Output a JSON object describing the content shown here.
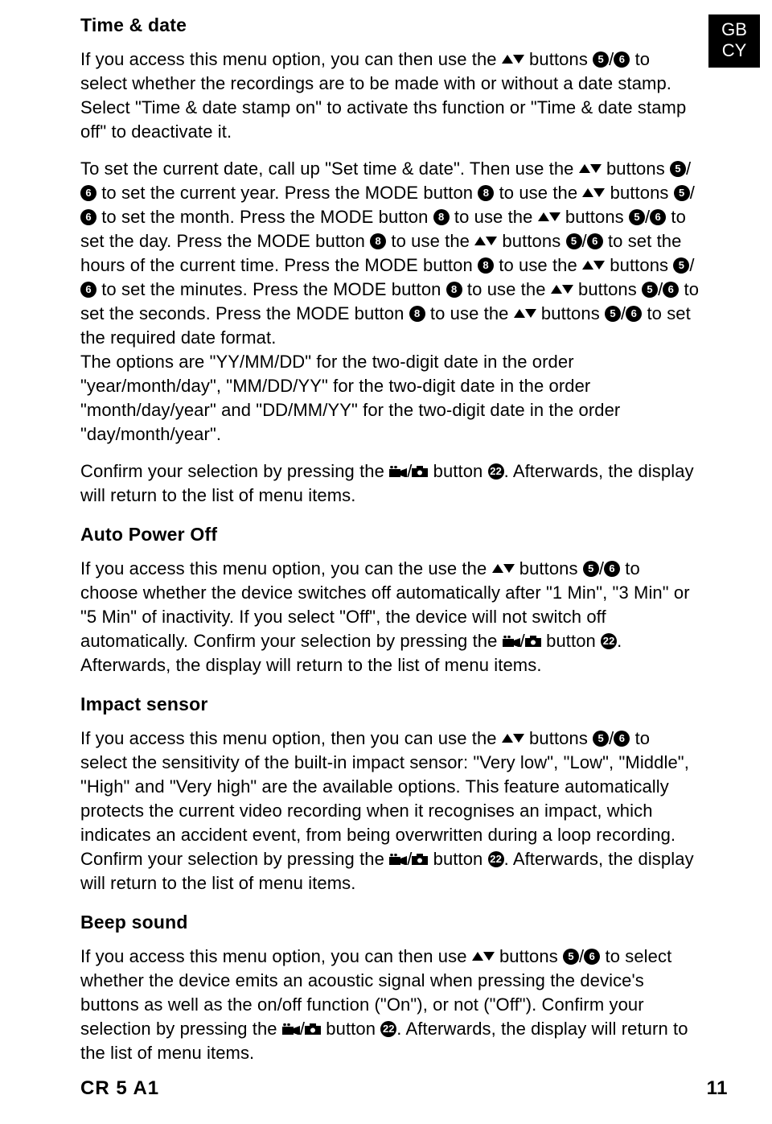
{
  "lang_tab": {
    "line1": "GB",
    "line2": "CY"
  },
  "footer": {
    "model": "CR 5 A1",
    "page": "11"
  },
  "refs": {
    "five": "5",
    "six": "6",
    "eight": "8",
    "twentytwo": "22"
  },
  "sections": {
    "time_date": {
      "heading": "Time & date",
      "p1a": "If you access this menu option, you can then use the ",
      "p1b": " buttons ",
      "p1c": "/",
      "p1d": " to select whether the recordings are to be made with or without a date stamp. Select \"Time & date stamp on\" to activate ths function or \"Time & date stamp off\" to deactivate it.",
      "p2a": "To set the current date, call up \"Set time & date\". Then use the ",
      "p2b": " buttons ",
      "p2c": "/",
      "p2d": " to set the current year. Press the MODE button ",
      "p2e": " to use the ",
      "p2f": " buttons ",
      "p2g": "/",
      "p2h": " to set the month. Press the MODE button ",
      "p2i": " to use the ",
      "p2j": " buttons ",
      "p2k": "/",
      "p2l": " to set the day. Press the MODE button ",
      "p2m": " to use the ",
      "p2n": " buttons ",
      "p2o": "/",
      "p2p": " to set the hours of the current time. Press the MODE button ",
      "p2q": " to use the ",
      "p2r": " buttons ",
      "p2s": "/",
      "p2t": " to set the minutes. Press the MODE button ",
      "p2u": " to use the ",
      "p2v": " buttons ",
      "p2w": "/",
      "p2x": " to set the seconds. Press the MODE button ",
      "p2y": " to use the ",
      "p2z": " buttons ",
      "p2aa": "/",
      "p2ab": " to set the required date format.",
      "p2ac": "The options are \"YY/MM/DD\" for the two-digit date in the order \"year/month/day\", \"MM/DD/YY\" for the two-digit date in the order \"month/day/year\" and \"DD/MM/YY\" for the two-digit date in the order \"day/month/year\".",
      "p3a": "Confirm your selection by pressing the ",
      "p3b": "/",
      "p3c": " button ",
      "p3d": ". Afterwards, the display will return to the list of menu items."
    },
    "auto_power_off": {
      "heading": "Auto Power Off",
      "p1a": "If you access this menu option, you can the use the ",
      "p1b": " buttons ",
      "p1c": "/",
      "p1d": " to choose whether the device switches off automatically after \"1 Min\", \"3 Min\" or \"5 Min\" of inactivity. If you select \"Off\", the device will not switch off automatically. Confirm your selection by pressing the ",
      "p1e": "/",
      "p1f": " button ",
      "p1g": ". Afterwards, the display will return to the list of menu items."
    },
    "impact_sensor": {
      "heading": "Impact sensor",
      "p1a": "If you access this menu option, then you can use the ",
      "p1b": " buttons ",
      "p1c": "/",
      "p1d": " to select the sensitivity of the built-in impact sensor: \"Very low\", \"Low\", \"Middle\", \"High\" and \"Very high\" are the available options. This feature automatically protects the current video recording when it recognises an impact, which indicates an accident event, from being overwritten during a loop recording. Confirm your selection by pressing the ",
      "p1e": "/",
      "p1f": " button ",
      "p1g": ". Afterwards, the display will return to the list of menu items."
    },
    "beep_sound": {
      "heading": "Beep sound",
      "p1a": "If you access this menu option, you can then use ",
      "p1b": " buttons ",
      "p1c": "/",
      "p1d": " to select whether the device emits an acoustic signal when pressing the device's buttons as well as the on/off function (\"On\"), or not (\"Off\"). Confirm your selection by pressing the ",
      "p1e": "/",
      "p1f": " button ",
      "p1g": ". Afterwards, the display will return to the list of menu items."
    }
  }
}
